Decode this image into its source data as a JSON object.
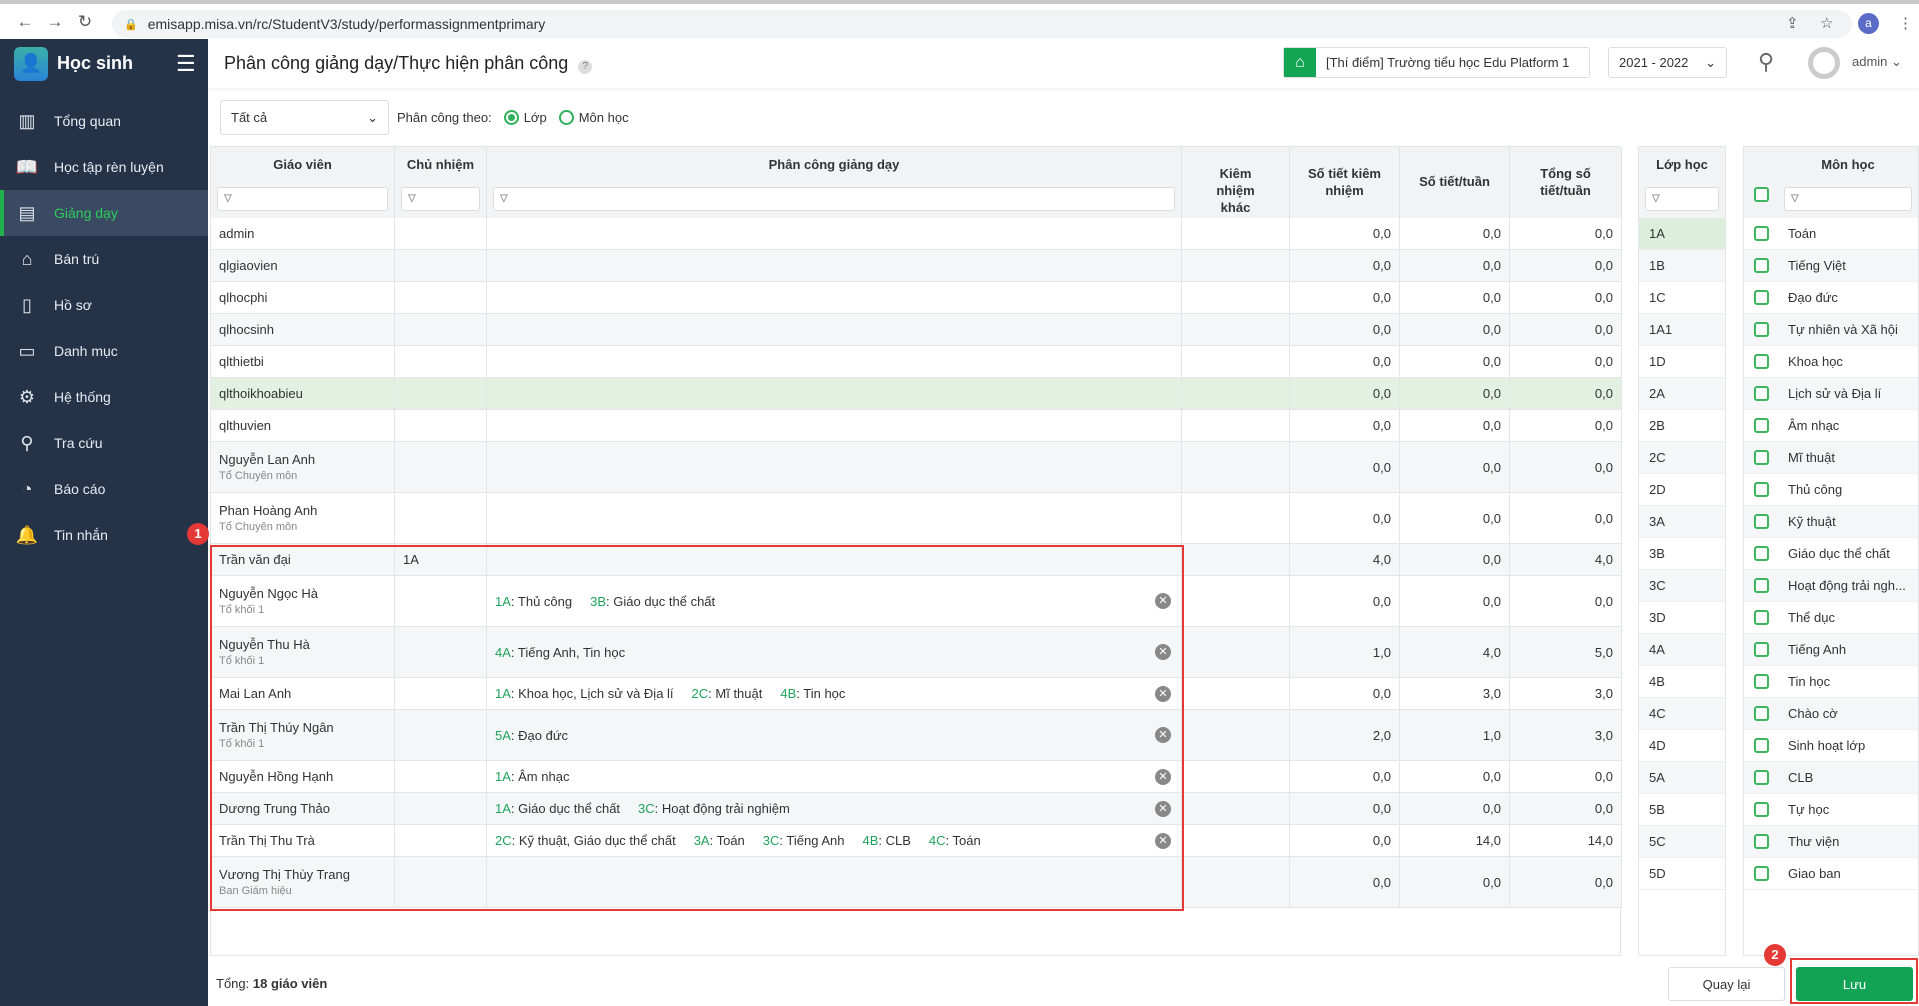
{
  "browser": {
    "url": "emisapp.misa.vn/rc/StudentV3/study/performassignmentprimary",
    "profile": "a"
  },
  "sidebar": {
    "app": "Học sinh",
    "items": [
      {
        "label": "Tổng quan",
        "icon": "bar-chart-icon"
      },
      {
        "label": "Học tập rèn luyện",
        "icon": "book-icon"
      },
      {
        "label": "Giảng dạy",
        "icon": "board-icon",
        "active": true
      },
      {
        "label": "Bán trú",
        "icon": "home-icon"
      },
      {
        "label": "Hồ sơ",
        "icon": "document-icon"
      },
      {
        "label": "Danh mục",
        "icon": "folder-icon"
      },
      {
        "label": "Hệ thống",
        "icon": "gear-icon"
      },
      {
        "label": "Tra cứu",
        "icon": "search-icon"
      },
      {
        "label": "Báo cáo",
        "icon": "pie-chart-icon"
      },
      {
        "label": "Tin nhắn",
        "icon": "bell-icon"
      }
    ]
  },
  "header": {
    "title": "Phân công giảng dạy/Thực hiện phân công",
    "help": "?",
    "school": "[Thí điểm] Trường tiểu học Edu Platform 1",
    "year": "2021 - 2022",
    "user": "admin"
  },
  "toolbar": {
    "filter": "Tất cả",
    "assign_by_label": "Phân công theo:",
    "option_class": "Lớp",
    "option_subject": "Môn học",
    "selected": "Lớp"
  },
  "table": {
    "headers": {
      "teacher": "Giáo viên",
      "homeroom": "Chủ nhiệm",
      "assign": "Phân công giảng dạy",
      "other": "Kiêm nhiệm khác",
      "concurrent": "Số tiết kiêm nhiệm",
      "weekly": "Số tiết/tuần",
      "total": "Tổng số tiết/tuần"
    },
    "rows": [
      {
        "name": "admin",
        "c": "0,0",
        "w": "0,0",
        "t": "0,0"
      },
      {
        "name": "qlgiaovien",
        "c": "0,0",
        "w": "0,0",
        "t": "0,0"
      },
      {
        "name": "qlhocphi",
        "c": "0,0",
        "w": "0,0",
        "t": "0,0"
      },
      {
        "name": "qlhocsinh",
        "c": "0,0",
        "w": "0,0",
        "t": "0,0"
      },
      {
        "name": "qlthietbi",
        "c": "0,0",
        "w": "0,0",
        "t": "0,0"
      },
      {
        "name": "qlthoikhoabieu",
        "c": "0,0",
        "w": "0,0",
        "t": "0,0",
        "selected": true
      },
      {
        "name": "qlthuvien",
        "c": "0,0",
        "w": "0,0",
        "t": "0,0"
      },
      {
        "name": "Nguyễn Lan Anh",
        "group": "Tổ Chuyên môn",
        "c": "0,0",
        "w": "0,0",
        "t": "0,0"
      },
      {
        "name": "Phan Hoàng Anh",
        "group": "Tổ Chuyên môn",
        "c": "0,0",
        "w": "0,0",
        "t": "0,0"
      },
      {
        "name": "Trần văn đại",
        "homeroom": "1A",
        "c": "4,0",
        "w": "0,0",
        "t": "4,0"
      },
      {
        "name": "Nguyễn Ngọc Hà",
        "group": "Tổ khối 1",
        "assign": [
          [
            "1A",
            "Thủ công"
          ],
          [
            "3B",
            "Giáo dục thể chất"
          ]
        ],
        "c": "0,0",
        "w": "0,0",
        "t": "0,0"
      },
      {
        "name": "Nguyễn Thu Hà",
        "group": "Tổ khối 1",
        "assign": [
          [
            "4A",
            "Tiếng Anh, Tin học"
          ]
        ],
        "c": "1,0",
        "w": "4,0",
        "t": "5,0"
      },
      {
        "name": "Mai Lan Anh",
        "assign": [
          [
            "1A",
            "Khoa học, Lịch sử và Địa lí"
          ],
          [
            "2C",
            "Mĩ thuật"
          ],
          [
            "4B",
            "Tin học"
          ]
        ],
        "c": "0,0",
        "w": "3,0",
        "t": "3,0"
      },
      {
        "name": "Trần Thị Thúy Ngân",
        "group": "Tổ khối 1",
        "assign": [
          [
            "5A",
            "Đạo đức"
          ]
        ],
        "c": "2,0",
        "w": "1,0",
        "t": "3,0"
      },
      {
        "name": "Nguyễn Hồng Hạnh",
        "assign": [
          [
            "1A",
            "Âm nhạc"
          ]
        ],
        "c": "0,0",
        "w": "0,0",
        "t": "0,0"
      },
      {
        "name": "Dương Trung Thảo",
        "assign": [
          [
            "1A",
            "Giáo dục thể chất"
          ],
          [
            "3C",
            "Hoạt động trải nghiệm"
          ]
        ],
        "c": "0,0",
        "w": "0,0",
        "t": "0,0"
      },
      {
        "name": "Trần Thị Thu Trà",
        "assign": [
          [
            "2C",
            "Kỹ thuật, Giáo dục thể chất"
          ],
          [
            "3A",
            "Toán"
          ],
          [
            "3C",
            "Tiếng Anh"
          ],
          [
            "4B",
            "CLB"
          ],
          [
            "4C",
            "Toán"
          ]
        ],
        "c": "0,0",
        "w": "14,0",
        "t": "14,0"
      },
      {
        "name": "Vương Thị Thùy Trang",
        "group": "Ban Giám hiệu",
        "c": "0,0",
        "w": "0,0",
        "t": "0,0"
      }
    ]
  },
  "classes": {
    "header": "Lớp học",
    "items": [
      "1A",
      "1B",
      "1C",
      "1A1",
      "1D",
      "2A",
      "2B",
      "2C",
      "2D",
      "3A",
      "3B",
      "3C",
      "3D",
      "4A",
      "4B",
      "4C",
      "4D",
      "5A",
      "5B",
      "5C",
      "5D"
    ]
  },
  "subjects": {
    "header": "Môn học",
    "items": [
      "Toán",
      "Tiếng Việt",
      "Đạo đức",
      "Tự nhiên và Xã hội",
      "Khoa học",
      "Lịch sử và Địa lí",
      "Âm nhạc",
      "Mĩ thuật",
      "Thủ công",
      "Kỹ thuật",
      "Giáo dục thể chất",
      "Hoạt động trải ngh...",
      "Thể dục",
      "Tiếng Anh",
      "Tin học",
      "Chào cờ",
      "Sinh hoạt lớp",
      "CLB",
      "Tự học",
      "Thư viện",
      "Giao ban"
    ]
  },
  "footer": {
    "total_label": "Tổng:",
    "total": "18 giáo viên",
    "back": "Quay lại",
    "save": "Lưu"
  },
  "annotations": {
    "one": "1",
    "two": "2"
  },
  "colors": {
    "sidebar": "#253349",
    "accent": "#12a454",
    "annotation": "#e53935"
  }
}
